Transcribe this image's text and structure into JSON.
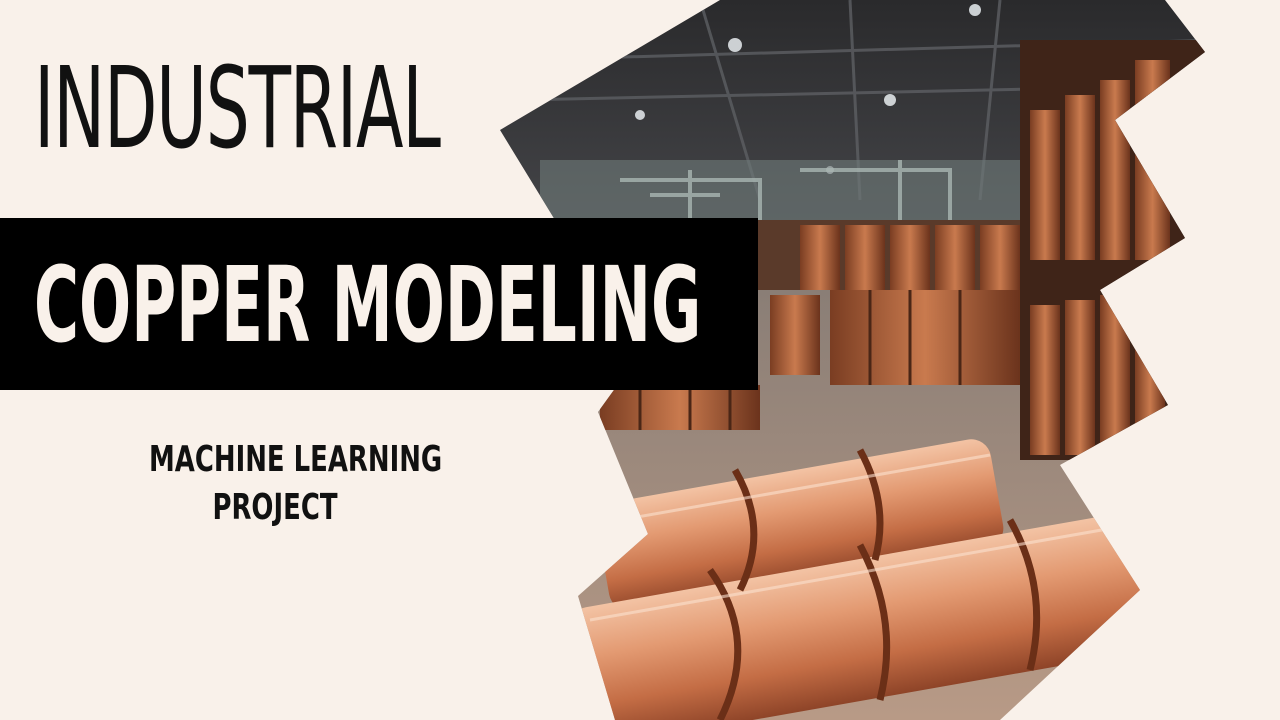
{
  "title": {
    "line1": "INDUSTRIAL",
    "line2": "COPPER MODELING"
  },
  "subtitle": {
    "line1": "MACHINE LEARNING",
    "line2": "PROJECT"
  },
  "colors": {
    "background": "#f9f1ea",
    "banner": "#000000",
    "title_text": "#111111",
    "banner_text": "#f9f1ea",
    "copper": "#c8734a"
  },
  "image": {
    "icon": "copper-wire-spools-warehouse-photo"
  }
}
